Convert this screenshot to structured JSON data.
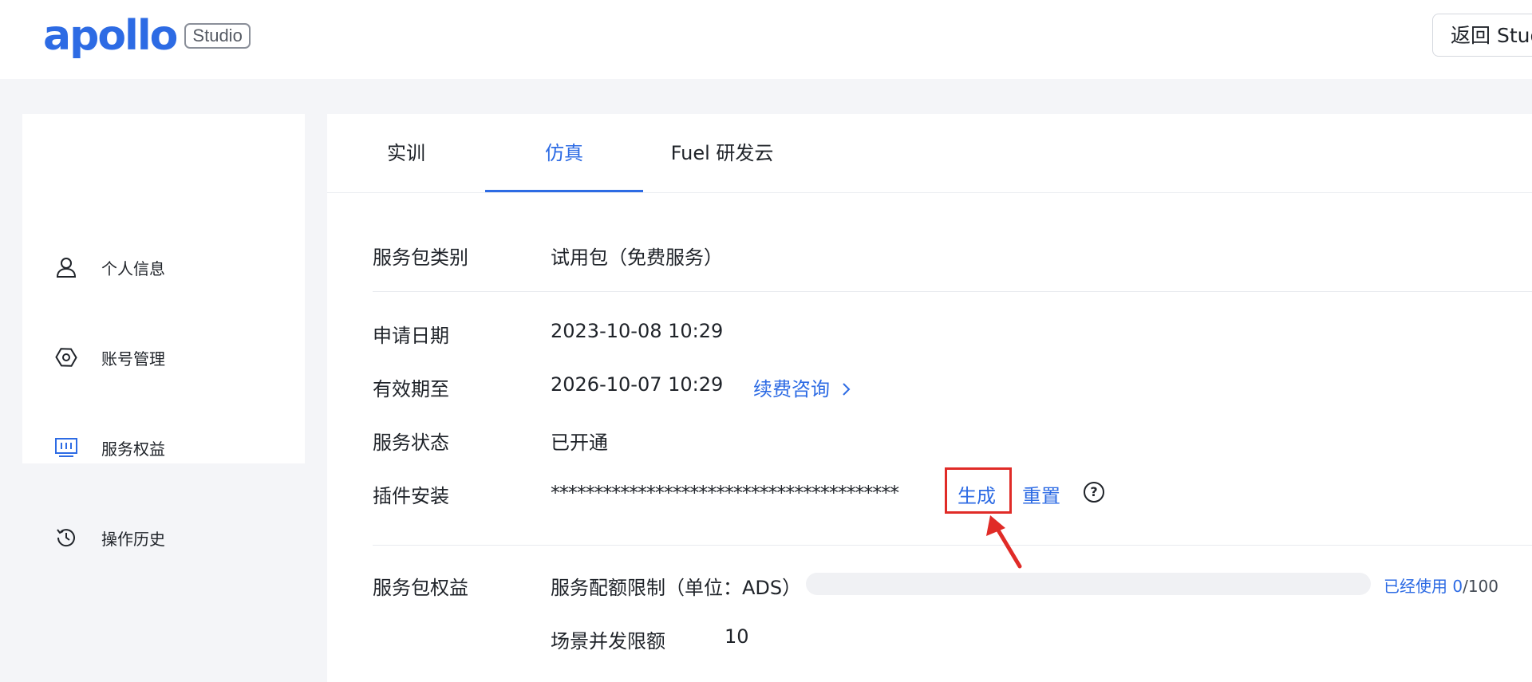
{
  "header": {
    "logo_text": "apollo",
    "logo_badge": "Studio",
    "back_button": "返回 Studio"
  },
  "sidebar": {
    "items": [
      {
        "label": "个人信息",
        "icon": "user-icon",
        "active": false
      },
      {
        "label": "账号管理",
        "icon": "hexagon-settings-icon",
        "active": false
      },
      {
        "label": "服务权益",
        "icon": "monitor-chart-icon",
        "active": true
      },
      {
        "label": "操作历史",
        "icon": "history-icon",
        "active": false
      }
    ]
  },
  "tabs": [
    {
      "label": "实训",
      "active": false
    },
    {
      "label": "仿真",
      "active": true
    },
    {
      "label": "Fuel 研发云",
      "active": false
    }
  ],
  "service": {
    "package_type_label": "服务包类别",
    "package_type_value": "试用包（免费服务）",
    "apply_date_label": "申请日期",
    "apply_date_value": "2023-10-08 10:29",
    "valid_until_label": "有效期至",
    "valid_until_value": "2026-10-07 10:29",
    "renew_link": "续费咨询",
    "status_label": "服务状态",
    "status_value": "已开通",
    "plugin_label": "插件安装",
    "plugin_masked": "****************************************",
    "generate_link": "生成",
    "reset_link": "重置",
    "help_symbol": "?",
    "benefits_label": "服务包权益",
    "quota_label": "服务配额限制（单位：ADS）",
    "quota_used_prefix": "已经使用 ",
    "quota_used": "0",
    "quota_total": "/100",
    "quota_fraction": 0,
    "concurrency_label": "场景并发限额",
    "concurrency_value": "10"
  },
  "colors": {
    "brand": "#2d6be4",
    "annotation": "#e02b27"
  }
}
